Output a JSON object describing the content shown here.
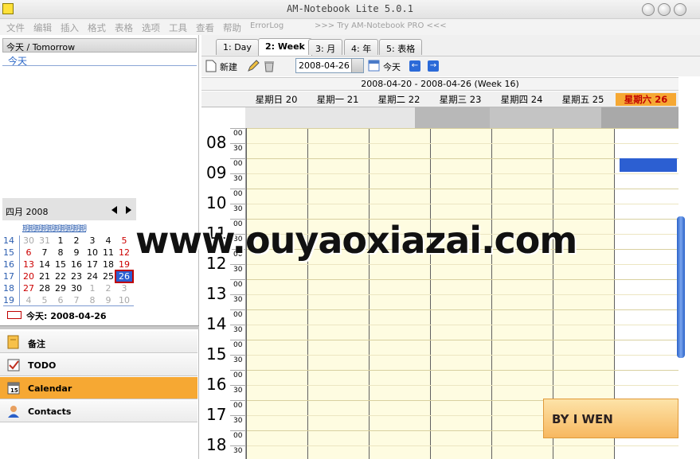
{
  "window": {
    "title": "AM-Notebook Lite  5.0.1"
  },
  "menu": [
    "文件",
    "编辑",
    "插入",
    "格式",
    "表格",
    "选项",
    "工具",
    "查看",
    "帮助",
    "ErrorLog",
    ">>> Try AM-Notebook PRO <<<"
  ],
  "today_panel": {
    "header": "今天 / Tomorrow",
    "link": "今天"
  },
  "calendar": {
    "month": "四月 2008",
    "dow_header": "期期期期期期期期期期",
    "weeks": [
      {
        "wk": "14",
        "days": [
          "30",
          "31",
          "1",
          "2",
          "3",
          "4",
          "5"
        ]
      },
      {
        "wk": "15",
        "days": [
          "6",
          "7",
          "8",
          "9",
          "10",
          "11",
          "12"
        ]
      },
      {
        "wk": "16",
        "days": [
          "13",
          "14",
          "15",
          "16",
          "17",
          "18",
          "19"
        ]
      },
      {
        "wk": "17",
        "days": [
          "20",
          "21",
          "22",
          "23",
          "24",
          "25",
          "26"
        ]
      },
      {
        "wk": "18",
        "days": [
          "27",
          "28",
          "29",
          "30",
          "1",
          "2",
          "3"
        ]
      },
      {
        "wk": "19",
        "days": [
          "4",
          "5",
          "6",
          "7",
          "8",
          "9",
          "10"
        ]
      }
    ],
    "today_caption": "今天: 2008-04-26"
  },
  "nav": [
    {
      "label": "备注",
      "icon": "note-icon"
    },
    {
      "label": "TODO",
      "icon": "todo-icon"
    },
    {
      "label": "Calendar",
      "icon": "calendar-icon"
    },
    {
      "label": "Contacts",
      "icon": "contacts-icon"
    }
  ],
  "tabs": [
    "1: Day",
    "2: Week",
    "3: 月",
    "4: 年",
    "5: 表格"
  ],
  "toolbar": {
    "new_label": "新建",
    "date": "2008-04-26",
    "today_label": "今天",
    "prev": "←",
    "next": "→"
  },
  "week": {
    "range": "2008-04-20  -  2008-04-26   (Week 16)",
    "days": [
      "星期日 20",
      "星期一 21",
      "星期二 22",
      "星期三 23",
      "星期四 24",
      "星期五 25",
      "星期六 26"
    ],
    "hours": [
      "08",
      "09",
      "10",
      "11",
      "12",
      "13",
      "14",
      "15",
      "16",
      "17",
      "18"
    ],
    "half": [
      "00",
      "30"
    ]
  },
  "colors": {
    "accent": "#f6a833",
    "weekend": "#cc0000",
    "event": "#2c5fd2",
    "cell": "#fefce1"
  },
  "watermark": "www.ouyaoxiazai.com",
  "brand": "BY I WEN"
}
